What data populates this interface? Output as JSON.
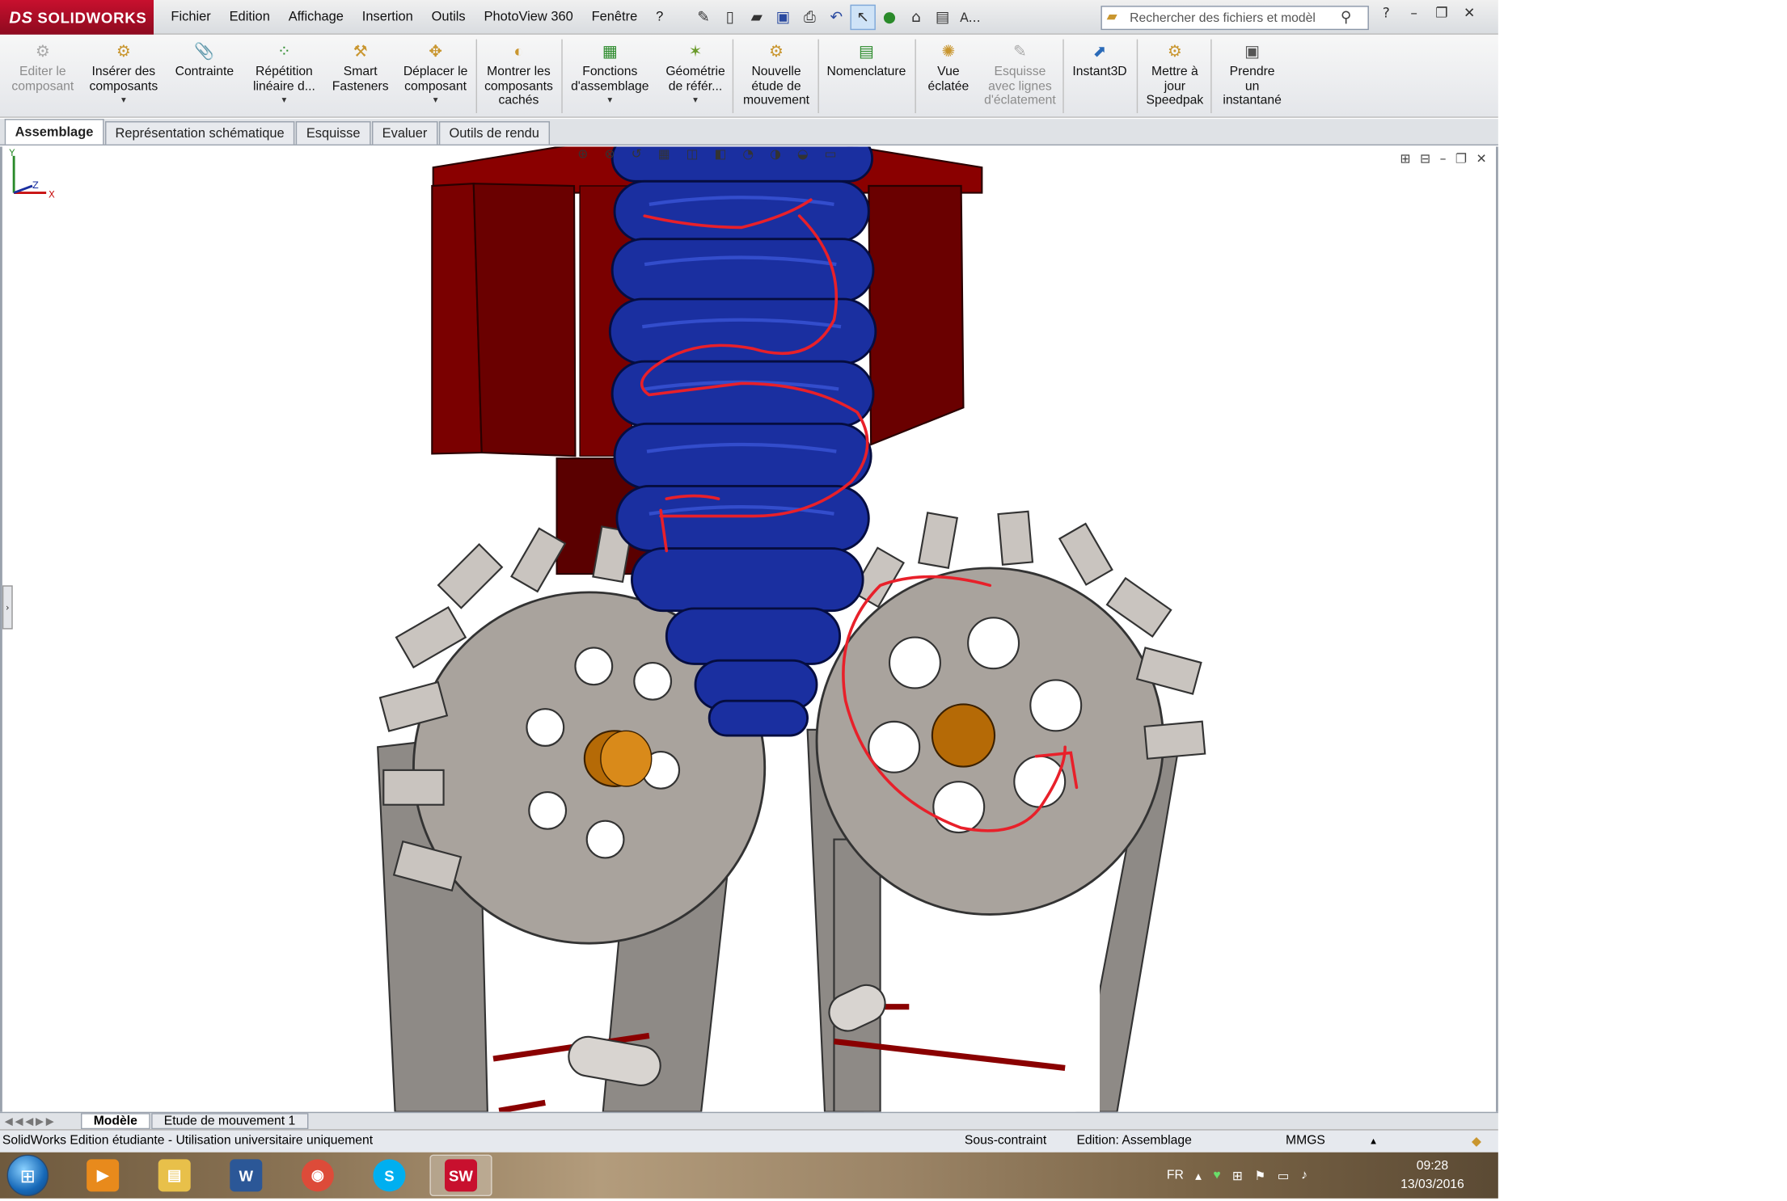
{
  "app": {
    "brand_prefix": "DS",
    "brand_name": "SOLIDWORKS"
  },
  "menu": [
    "Fichier",
    "Edition",
    "Affichage",
    "Insertion",
    "Outils",
    "PhotoView 360",
    "Fenêtre",
    "?"
  ],
  "quick_toolbar": {
    "more_label": "A..."
  },
  "search": {
    "placeholder": "Rechercher des fichiers et modèl"
  },
  "ribbon": [
    {
      "id": "editer",
      "label1": "Editer le",
      "label2": "composant",
      "label3": "",
      "disabled": true,
      "dropdown": false
    },
    {
      "id": "inserer",
      "label1": "Insérer des",
      "label2": "composants",
      "label3": "",
      "disabled": false,
      "dropdown": true
    },
    {
      "id": "contrainte",
      "label1": "Contrainte",
      "label2": "",
      "label3": "",
      "disabled": false,
      "dropdown": false
    },
    {
      "id": "repetition",
      "label1": "Répétition",
      "label2": "linéaire d...",
      "label3": "",
      "disabled": false,
      "dropdown": true
    },
    {
      "id": "smart",
      "label1": "Smart",
      "label2": "Fasteners",
      "label3": "",
      "disabled": false,
      "dropdown": false
    },
    {
      "id": "deplacer",
      "label1": "Déplacer le",
      "label2": "composant",
      "label3": "",
      "disabled": false,
      "dropdown": true
    },
    {
      "id": "montrer",
      "label1": "Montrer les",
      "label2": "composants",
      "label3": "cachés",
      "disabled": false,
      "dropdown": false
    },
    {
      "id": "fonctions",
      "label1": "Fonctions",
      "label2": "d'assemblage",
      "label3": "",
      "disabled": false,
      "dropdown": true
    },
    {
      "id": "geometrie",
      "label1": "Géométrie",
      "label2": "de référ...",
      "label3": "",
      "disabled": false,
      "dropdown": true
    },
    {
      "id": "nouvelle",
      "label1": "Nouvelle",
      "label2": "étude de",
      "label3": "mouvement",
      "disabled": false,
      "dropdown": false
    },
    {
      "id": "nomenclature",
      "label1": "Nomenclature",
      "label2": "",
      "label3": "",
      "disabled": false,
      "dropdown": false
    },
    {
      "id": "vue",
      "label1": "Vue",
      "label2": "éclatée",
      "label3": "",
      "disabled": false,
      "dropdown": false
    },
    {
      "id": "esquisse",
      "label1": "Esquisse",
      "label2": "avec lignes",
      "label3": "d'éclatement",
      "disabled": true,
      "dropdown": false
    },
    {
      "id": "instant3d",
      "label1": "Instant3D",
      "label2": "",
      "label3": "",
      "disabled": false,
      "dropdown": false
    },
    {
      "id": "speedpak",
      "label1": "Mettre à",
      "label2": "jour",
      "label3": "Speedpak",
      "disabled": false,
      "dropdown": false
    },
    {
      "id": "instantane",
      "label1": "Prendre",
      "label2": "un",
      "label3": "instantané",
      "disabled": false,
      "dropdown": false
    }
  ],
  "tabs": [
    "Assemblage",
    "Représentation schématique",
    "Esquisse",
    "Evaluer",
    "Outils de rendu"
  ],
  "triad": {
    "x": "X",
    "y": "Y",
    "z": "Z"
  },
  "bottom_tabs": [
    "Modèle",
    "Etude de mouvement 1"
  ],
  "status": {
    "left": "SolidWorks Edition étudiante - Utilisation universitaire uniquement",
    "constraint": "Sous-contraint",
    "editing": "Edition: Assemblage",
    "units": "MMGS",
    "units_arrow": "▲"
  },
  "taskbar": {
    "lang": "FR",
    "time": "09:28",
    "date": "13/03/2016",
    "apps": [
      {
        "id": "media",
        "glyph": "▶",
        "color": "#e88a1c"
      },
      {
        "id": "explorer",
        "glyph": "▤",
        "color": "#e8c04a"
      },
      {
        "id": "word",
        "glyph": "W",
        "color": "#2b5797"
      },
      {
        "id": "chrome",
        "glyph": "◉",
        "color": "#dd4b39"
      },
      {
        "id": "skype",
        "glyph": "S",
        "color": "#00aff0"
      },
      {
        "id": "solidworks",
        "glyph": "SW",
        "color": "#c8102e"
      }
    ]
  },
  "colors": {
    "frame_red": "#7a0000",
    "spring_blue": "#1a2fa0",
    "gear_gray": "#a9a39d",
    "hub_orange": "#b56a06",
    "annotation": "#e8202a"
  }
}
